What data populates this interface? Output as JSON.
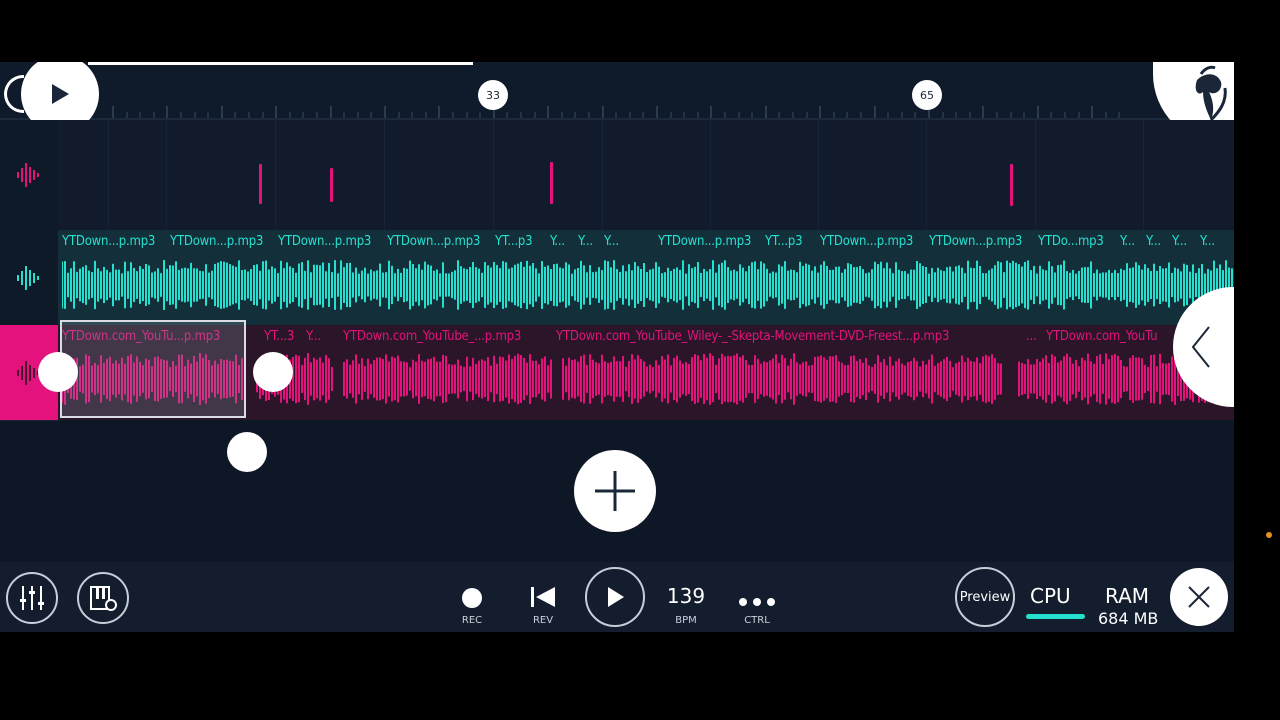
{
  "ruler": {
    "markers": [
      "33",
      "65"
    ]
  },
  "tracks": {
    "track2_labels": [
      "YTDown...p.mp3",
      "YTDown...p.mp3",
      "YTDown...p.mp3",
      "YTDown...p.mp3",
      "YT...p3",
      "Y...",
      "Y...",
      "Y...",
      "YTDown...p.mp3",
      "YT...p3",
      "YTDown...p.mp3",
      "YTDown...p.mp3",
      "YTDo...mp3",
      "Y...",
      "Y...",
      "Y...",
      "Y..."
    ],
    "track3_labels": [
      "YTDown.com_YouTu...p.mp3",
      "YT...3",
      "Y...",
      "YTDown.com_YouTube_...p.mp3",
      "YTDown.com_YouTube_Wiley-_-Skepta-Movement-DVD-Freest...p.mp3",
      "...",
      "YTDown.com_YouTu"
    ]
  },
  "toolbar": {
    "rec_label": "REC",
    "rev_label": "REV",
    "bpm_value": "139",
    "bpm_label": "BPM",
    "ctrl_label": "CTRL",
    "preview_label": "Preview",
    "cpu_label": "CPU",
    "ram_label": "RAM",
    "ram_value": "684 MB",
    "cpu_usage": 0.85
  },
  "colors": {
    "accent_teal": "#26e0cf",
    "accent_pink": "#e4127c",
    "background": "#0e1726"
  },
  "icons": {
    "track_head": "waveform-icon",
    "mixer": "mixer-icon",
    "piano_settings": "piano-settings-icon",
    "logo": "fl-studio-logo"
  }
}
